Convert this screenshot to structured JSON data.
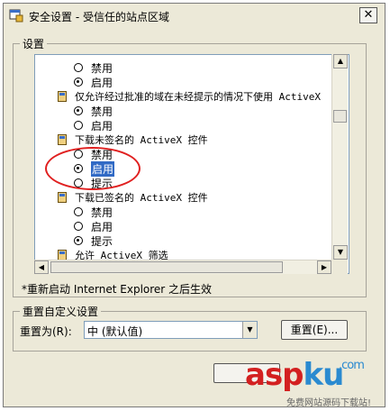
{
  "window": {
    "title": "安全设置 - 受信任的站点区域",
    "close_glyph": "✕"
  },
  "settings": {
    "group_label": "设置",
    "rows": [
      {
        "kind": "radio",
        "label": "禁用",
        "checked": false
      },
      {
        "kind": "radio",
        "label": "启用",
        "checked": true
      },
      {
        "kind": "category",
        "label": "仅允许经过批准的域在未经提示的情况下使用 ActiveX"
      },
      {
        "kind": "radio",
        "label": "禁用",
        "checked": true
      },
      {
        "kind": "radio",
        "label": "启用",
        "checked": false
      },
      {
        "kind": "category",
        "label": "下载未签名的 ActiveX 控件"
      },
      {
        "kind": "radio",
        "label": "禁用",
        "checked": false
      },
      {
        "kind": "radio",
        "label": "启用",
        "checked": true,
        "selected": true
      },
      {
        "kind": "radio",
        "label": "提示",
        "checked": false
      },
      {
        "kind": "category",
        "label": "下载已签名的 ActiveX 控件"
      },
      {
        "kind": "radio",
        "label": "禁用",
        "checked": false
      },
      {
        "kind": "radio",
        "label": "启用",
        "checked": false
      },
      {
        "kind": "radio",
        "label": "提示",
        "checked": true
      },
      {
        "kind": "category",
        "label": "允许 ActiveX 筛选"
      }
    ],
    "note": "*重新启动 Internet Explorer 之后生效"
  },
  "reset": {
    "group_label": "重置自定义设置",
    "reset_to_label": "重置为(R):",
    "combo_value": "中  (默认值)",
    "reset_button": "重置(E)..."
  },
  "watermark": {
    "asp": "asp",
    "ku": "ku",
    "com": ".com",
    "sub": "免费网站源码下载站!"
  },
  "colors": {
    "dialog_bg": "#ece9d8",
    "selection": "#316ac5",
    "highlight_ring": "#e02020"
  }
}
